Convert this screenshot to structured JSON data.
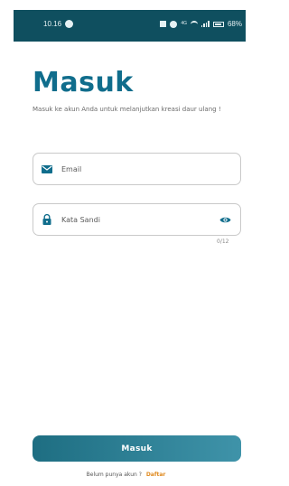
{
  "status_bar": {
    "time": "10.16",
    "network_label": "4G",
    "battery": "68%"
  },
  "login": {
    "title": "Masuk",
    "subtitle": "Masuk ke akun Anda untuk melanjutkan kreasi daur ulang !"
  },
  "email_field": {
    "placeholder": "Email",
    "value": "",
    "icon": "envelope-icon"
  },
  "password_field": {
    "placeholder": "Kata Sandi",
    "value": "",
    "icon": "lock-icon",
    "toggle_icon": "eye-icon",
    "counter": "0/12"
  },
  "submit": {
    "label": "Masuk"
  },
  "signup": {
    "prompt": "Belum punya akun ?",
    "link": "Daftar"
  },
  "colors": {
    "primary": "#106d8c",
    "button_start": "#1e6e82",
    "button_end": "#3f93a9",
    "link": "#e08a1f",
    "status_bar": "#0f4f5f"
  }
}
